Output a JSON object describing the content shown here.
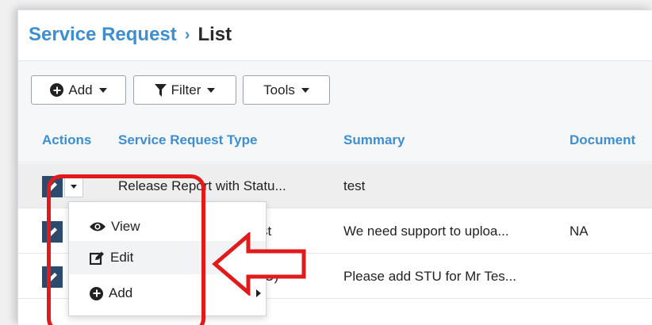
{
  "header": {
    "breadcrumb_parent": "Service Request",
    "breadcrumb_separator": "›",
    "breadcrumb_current": "List"
  },
  "toolbar": {
    "add_label": "Add",
    "filter_label": "Filter",
    "tools_label": "Tools"
  },
  "table": {
    "columns": [
      "Actions",
      "Service Request Type",
      "Summary",
      "Document"
    ],
    "rows": [
      {
        "type": "Release Report with Statu...",
        "summary": "test",
        "document": ""
      },
      {
        "type": "st",
        "summary": "We need support to uploa...",
        "document": "NA"
      },
      {
        "type": "TU)",
        "summary": "Please add STU for Mr Tes...",
        "document": ""
      }
    ]
  },
  "dropdown_menu": {
    "items": [
      {
        "label": "View",
        "icon": "eye-icon"
      },
      {
        "label": "Edit",
        "icon": "edit-icon"
      },
      {
        "label": "Add",
        "icon": "plus-circle-icon"
      }
    ]
  },
  "colors": {
    "accent": "#3d8fd1",
    "edit_button": "#2c4a6b",
    "annotation": "#e11b1b"
  }
}
